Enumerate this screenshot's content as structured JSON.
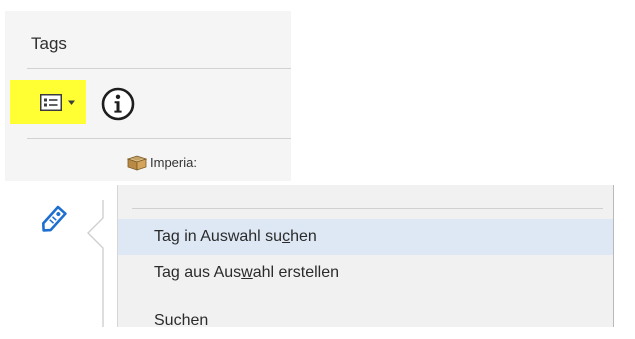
{
  "tags_panel": {
    "title": "Tags",
    "options_button": {
      "icon": "list-view-icon",
      "caret_icon": "dropdown-caret-icon",
      "highlight_color": "#ffff33"
    },
    "info_button": {
      "icon": "info-icon"
    },
    "tree": {
      "root": {
        "icon": "package-box-icon",
        "label": "Imperia:"
      }
    }
  },
  "sidebar": {
    "icon": "tag-icon",
    "icon_color": "#1f6fd0"
  },
  "context_menu": {
    "items": [
      {
        "pre": "Tag in Auswahl su",
        "mnemonic": "c",
        "post": "hen",
        "highlighted": true
      },
      {
        "pre": "Tag aus Aus",
        "mnemonic": "w",
        "post": "ahl erstellen",
        "highlighted": false
      },
      {
        "pre": "Suchen",
        "mnemonic": "",
        "post": "",
        "highlighted": false
      }
    ]
  }
}
